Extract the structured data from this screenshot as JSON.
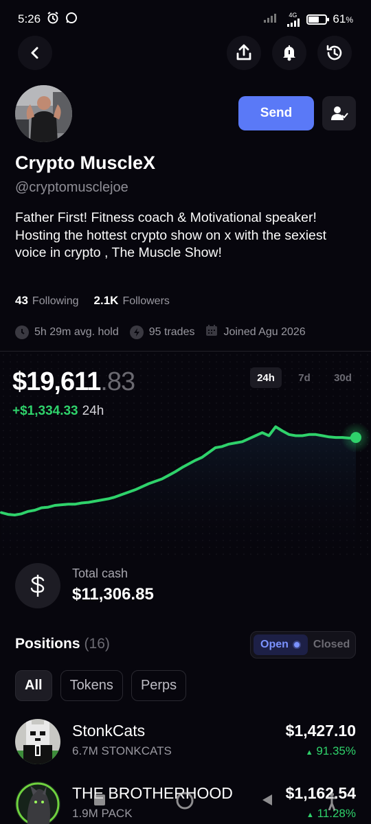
{
  "status": {
    "time": "5:26",
    "network": "4G",
    "battery": "61",
    "battery_fill": 0.61,
    "battery_unit": "%"
  },
  "profile": {
    "display_name": "Crypto MuscleX",
    "handle": "@cryptomusclejoe",
    "bio": "Father First!  Fitness coach & Motivational speaker! Hosting the hottest crypto show on x with the sexiest voice in crypto , The Muscle Show!",
    "following_count": "43",
    "following_label": "Following",
    "followers_count": "2.1K",
    "followers_label": "Followers",
    "avg_hold": "5h 29m avg. hold",
    "trades": "95 trades",
    "joined": "Joined Agu 2026"
  },
  "actions": {
    "send_label": "Send"
  },
  "portfolio": {
    "balance_whole": "$19,611",
    "balance_cents": ".83",
    "change": "+$1,334.33",
    "change_period": "24h",
    "ranges": [
      "24h",
      "7d",
      "30d"
    ],
    "active_range": "24h"
  },
  "chart_data": {
    "type": "line",
    "x": [
      0,
      1,
      2,
      3,
      4,
      5,
      6,
      7,
      8,
      9,
      10,
      11,
      12,
      13,
      14,
      15,
      16,
      17,
      18,
      19,
      20,
      21,
      22,
      23,
      24,
      25,
      26,
      27,
      28,
      29,
      30,
      31,
      32,
      33,
      34,
      35,
      36,
      37,
      38,
      39,
      40,
      41,
      42,
      43,
      44,
      45,
      46,
      47,
      48,
      49,
      50,
      51,
      52,
      53
    ],
    "series": [
      {
        "values": [
          12,
          9,
          8,
          10,
          14,
          16,
          20,
          21,
          24,
          25,
          26,
          26,
          28,
          29,
          31,
          33,
          35,
          38,
          42,
          46,
          50,
          55,
          60,
          64,
          68,
          74,
          80,
          87,
          93,
          99,
          104,
          112,
          120,
          122,
          126,
          128,
          130,
          135,
          140,
          145,
          140,
          155,
          148,
          142,
          140,
          140,
          142,
          142,
          140,
          138,
          137,
          137,
          136,
          137
        ]
      }
    ],
    "xlabel": "",
    "ylabel": "",
    "grid": false
  },
  "cash": {
    "label": "Total cash",
    "value": "$11,306.85"
  },
  "positions": {
    "title": "Positions",
    "count": "(16)",
    "open_label": "Open",
    "closed_label": "Closed",
    "filters": [
      "All",
      "Tokens",
      "Perps"
    ],
    "items": [
      {
        "name": "StonkCats",
        "amount": "6.7M STONKCATS",
        "value": "$1,427.10",
        "change": "91.35%"
      },
      {
        "name": "THE BROTHERHOOD",
        "amount": "1.9M PACK",
        "value": "$1,162.54",
        "change": "11.28%"
      }
    ]
  },
  "colors": {
    "accent": "#5a79f7",
    "positive": "#2fd26b",
    "background": "#07060d"
  },
  "icons": {
    "back": "chevron-left-icon",
    "share": "share-icon",
    "bell": "bell-icon",
    "history": "history-icon",
    "follow": "user-check-icon"
  }
}
